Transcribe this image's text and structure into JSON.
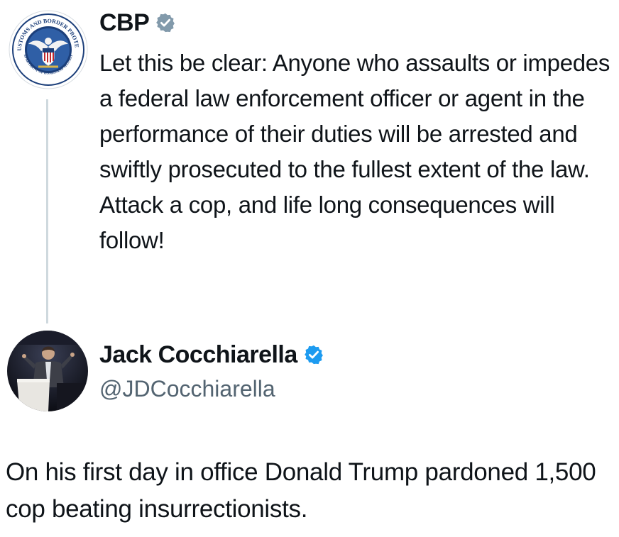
{
  "reply_post": {
    "author_name": "CBP",
    "text": "Let this be clear: Anyone who assaults or impedes a federal law enforcement officer or agent in the performance of their duties will be arrested and swiftly prosecuted to the fullest extent of the law. Attack a cop, and life long consequences will follow!",
    "avatar": {
      "icon": "cbp-seal-icon",
      "seal_text": "U.S. CUSTOMS AND BORDER PROTECTION",
      "seal_text_bottom": "DEPARTMENT OF HOMELAND SECURITY"
    },
    "verified_badge": "verified-gray-badge-icon",
    "badge_color": "#829aab"
  },
  "main_post": {
    "author_name": "Jack Cocchiarella",
    "handle": "@JDCocchiarella",
    "text": "On his first day in office Donald Trump pardoned 1,500 cop beating insurrectionists.",
    "avatar": {
      "icon": "speaker-photo-avatar"
    },
    "verified_badge": "verified-blue-badge-icon",
    "badge_color": "#1d9bf0"
  }
}
